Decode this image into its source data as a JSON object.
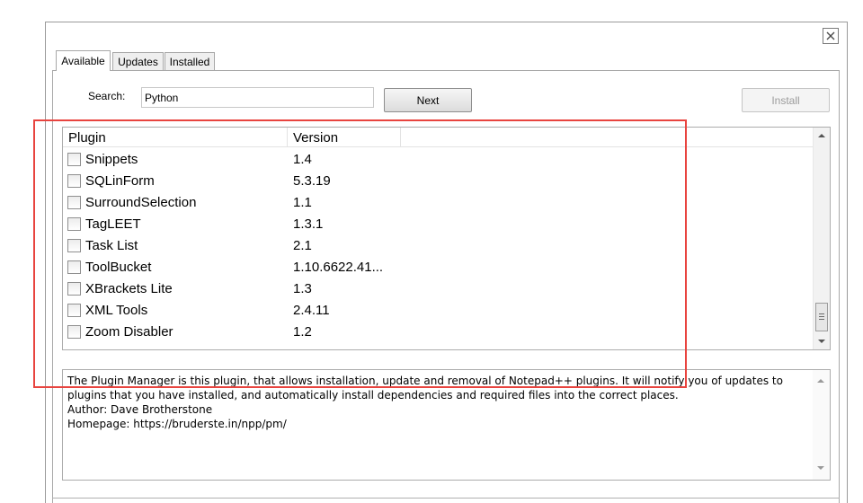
{
  "tabs": [
    {
      "label": "Available",
      "active": true
    },
    {
      "label": "Updates",
      "active": false
    },
    {
      "label": "Installed",
      "active": false
    }
  ],
  "search": {
    "label": "Search:",
    "value": "Python"
  },
  "buttons": {
    "next": "Next",
    "install": "Install"
  },
  "list": {
    "columns": {
      "plugin": "Plugin",
      "version": "Version"
    },
    "rows": [
      {
        "name": "Snippets",
        "version": "1.4",
        "checked": false
      },
      {
        "name": "SQLinForm",
        "version": "5.3.19",
        "checked": false
      },
      {
        "name": "SurroundSelection",
        "version": "1.1",
        "checked": false
      },
      {
        "name": "TagLEET",
        "version": "1.3.1",
        "checked": false
      },
      {
        "name": "Task List",
        "version": "2.1",
        "checked": false
      },
      {
        "name": "ToolBucket",
        "version": "1.10.6622.41...",
        "checked": false
      },
      {
        "name": "XBrackets Lite",
        "version": "1.3",
        "checked": false
      },
      {
        "name": "XML Tools",
        "version": "2.4.11",
        "checked": false
      },
      {
        "name": "Zoom Disabler",
        "version": "1.2",
        "checked": false
      }
    ]
  },
  "description": {
    "lines": [
      "The Plugin Manager is this plugin, that allows installation, update and removal of Notepad++ plugins. It will notify you of updates to plugins that you have installed, and automatically install dependencies and required files into the correct places.",
      "Author: Dave Brotherstone",
      "Homepage: https://bruderste.in/npp/pm/"
    ]
  },
  "icons": {
    "close": "close-icon",
    "scroll_up": "chevron-up-icon",
    "scroll_down": "chevron-down-icon"
  },
  "colors": {
    "highlight": "#e8443f"
  }
}
